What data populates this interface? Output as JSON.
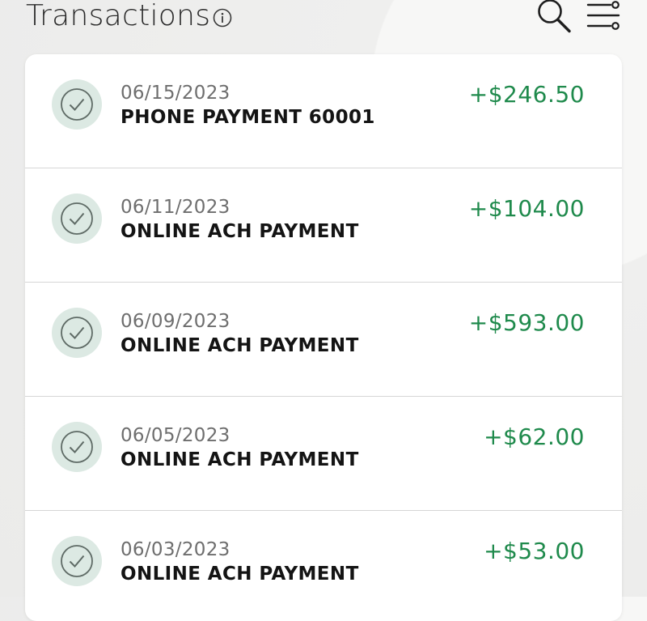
{
  "header": {
    "title": "Transactions",
    "info_icon": "info-icon",
    "search_icon": "search-icon",
    "filter_icon": "filter-icon"
  },
  "colors": {
    "amount_positive": "#1f8a4c",
    "status_circle_bg": "#dce9e3",
    "card_bg": "#ffffff"
  },
  "transactions": [
    {
      "date": "06/15/2023",
      "description": "PHONE PAYMENT 60001",
      "amount": "+$246.50",
      "status_icon": "check-circle-icon"
    },
    {
      "date": "06/11/2023",
      "description": "ONLINE ACH PAYMENT",
      "amount": "+$104.00",
      "status_icon": "check-circle-icon"
    },
    {
      "date": "06/09/2023",
      "description": "ONLINE ACH PAYMENT",
      "amount": "+$593.00",
      "status_icon": "check-circle-icon"
    },
    {
      "date": "06/05/2023",
      "description": "ONLINE ACH PAYMENT",
      "amount": "+$62.00",
      "status_icon": "check-circle-icon"
    },
    {
      "date": "06/03/2023",
      "description": "ONLINE ACH PAYMENT",
      "amount": "+$53.00",
      "status_icon": "check-circle-icon"
    }
  ]
}
